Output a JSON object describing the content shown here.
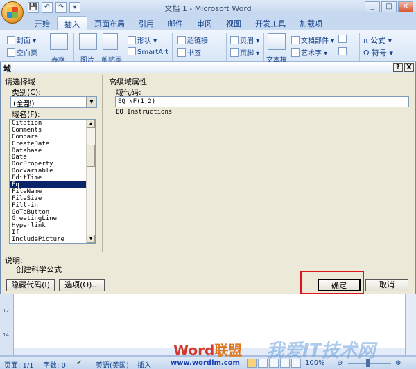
{
  "window": {
    "title": "文档 1 - Microsoft Word",
    "controls": [
      "_",
      "□",
      "✕"
    ]
  },
  "qat": [
    "💾",
    "↶",
    "↷",
    "▾"
  ],
  "ribbon": {
    "tabs": [
      "开始",
      "插入",
      "页面布局",
      "引用",
      "邮件",
      "审阅",
      "视图",
      "开发工具",
      "加载项"
    ],
    "active_tab": "插入",
    "items": {
      "cover": "封面 ▾",
      "blank": "空白页",
      "table": "表格",
      "picture": "图片",
      "clipart": "剪贴画",
      "shapes": "形状 ▾",
      "smartart": "SmartArt",
      "hyperlink": "超链接",
      "bookmark": "书签",
      "header": "页眉 ▾",
      "footer": "页脚 ▾",
      "textbox": "文本框",
      "quickparts": "文档部件 ▾",
      "wordart": "艺术字 ▾",
      "formula": "π 公式 ▾",
      "symbol": "Ω 符号 ▾"
    }
  },
  "dialog": {
    "title": "域",
    "help": "?",
    "close": "X",
    "left_group": "请选择域",
    "category_label": "类别(C):",
    "category_value": "(全部)",
    "fieldname_label": "域名(F):",
    "fields": [
      "Citation",
      "Comments",
      "Compare",
      "CreateDate",
      "Database",
      "Date",
      "DocProperty",
      "DocVariable",
      "EditTime",
      "Eq",
      "FileName",
      "FileSize",
      "Fill-in",
      "GoToButton",
      "GreetingLine",
      "Hyperlink",
      "If",
      "IncludePicture"
    ],
    "selected_field": "Eq",
    "right_group": "高级域属性",
    "code_label": "域代码:",
    "code_value": "EQ \\F(1,2)",
    "instructions": "EQ Instructions",
    "desc_label": "说明:",
    "desc_text": "创建科学公式",
    "hide_code_button": "隐藏代码(I)",
    "options_button": "选项(O)...",
    "ok_button": "确定",
    "cancel_button": "取消"
  },
  "document": {
    "ruler_numbers": [
      "12",
      "14"
    ]
  },
  "watermark": {
    "left_word": "Word",
    "left_cn": "联盟",
    "left_url": "www.wordlm.com",
    "right_text": "我爱IT技术网"
  },
  "status": {
    "page": "页面: 1/1",
    "words": "字数: 0",
    "language": "英语(美国)",
    "mode": "插入",
    "zoom": "100%"
  },
  "colors": {
    "ribbon_text": "#15428b",
    "selection": "#0a246a",
    "highlight": "#e0141a",
    "dialog_bg": "#ece9d8"
  }
}
